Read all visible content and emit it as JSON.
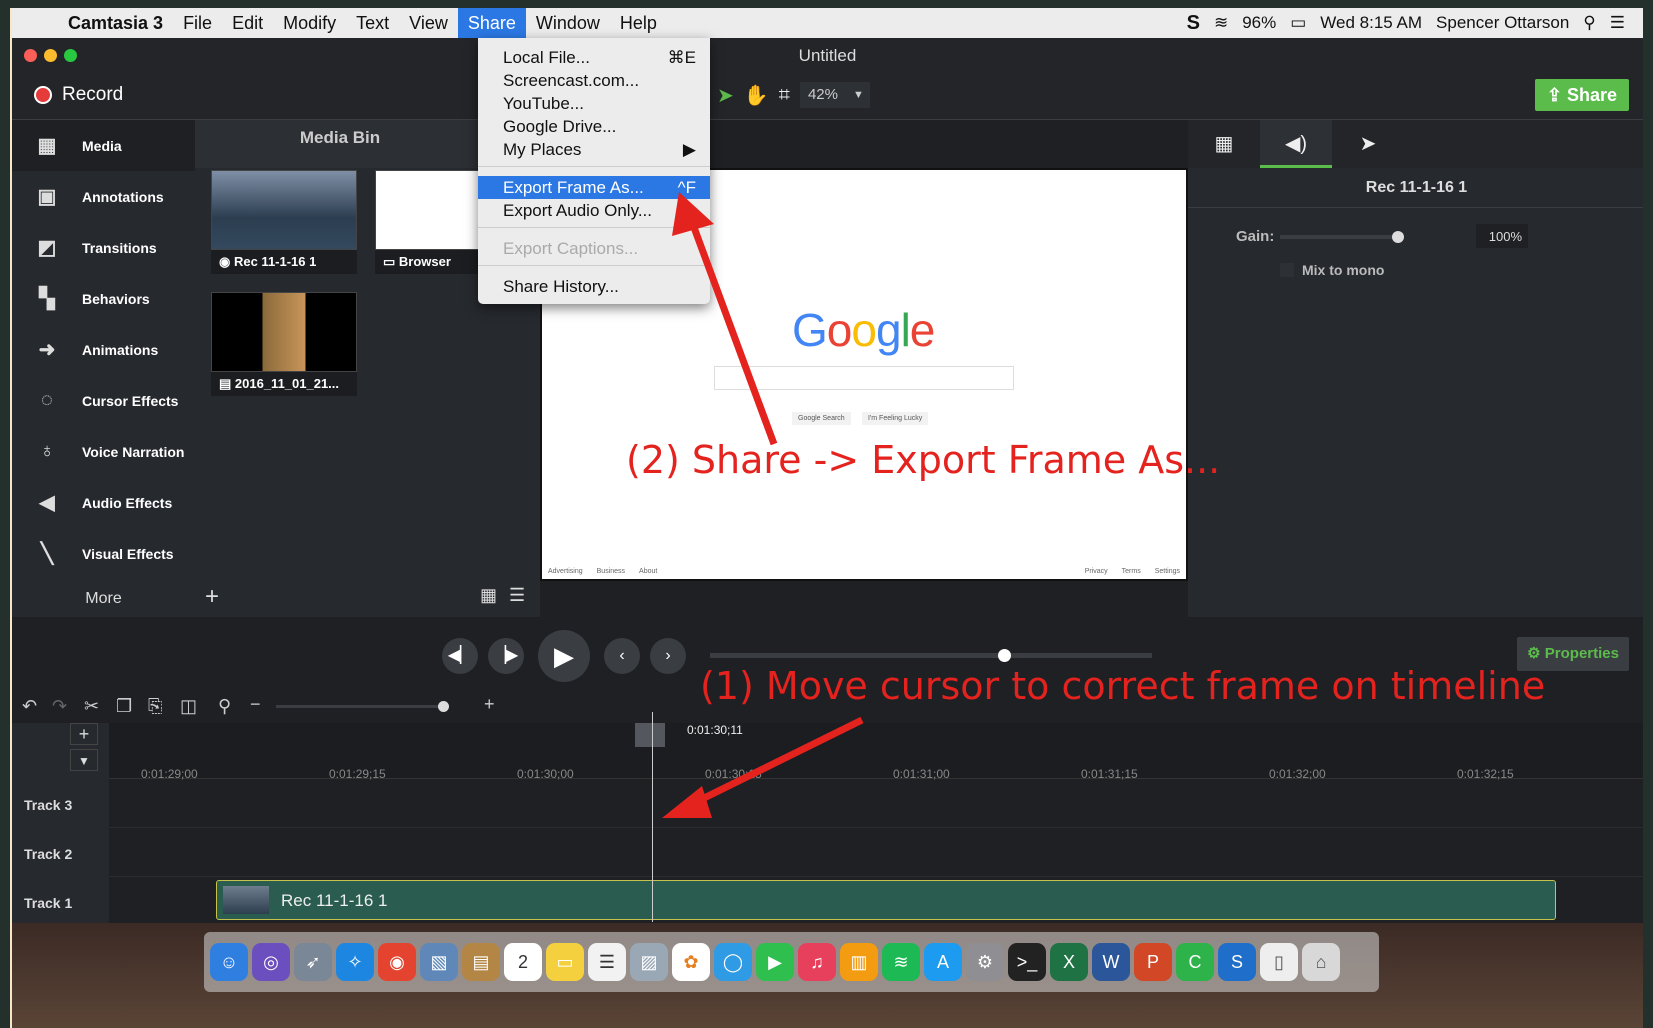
{
  "menubar": {
    "app": "Camtasia 3",
    "items": [
      "File",
      "Edit",
      "Modify",
      "Text",
      "View",
      "Share",
      "Window",
      "Help"
    ],
    "battery": "96%",
    "clock": "Wed 8:15 AM",
    "user": "Spencer Ottarson"
  },
  "window": {
    "title": "Untitled"
  },
  "toolbar": {
    "record": "Record",
    "zoom": "42%",
    "share": "Share"
  },
  "sidebar": {
    "items": [
      "Media",
      "Annotations",
      "Transitions",
      "Behaviors",
      "Animations",
      "Cursor Effects",
      "Voice Narration",
      "Audio Effects",
      "Visual Effects"
    ],
    "more": "More"
  },
  "bin": {
    "title": "Media Bin",
    "items": [
      "Rec 11-1-16 1",
      "Browser",
      "2016_11_01_21..."
    ]
  },
  "share_menu": {
    "items": [
      {
        "label": "Local File...",
        "shortcut": "⌘E"
      },
      {
        "label": "Screencast.com..."
      },
      {
        "label": "YouTube..."
      },
      {
        "label": "Google Drive..."
      },
      {
        "label": "My Places"
      },
      {
        "label": "Export Frame As...",
        "shortcut": "^F"
      },
      {
        "label": "Export Audio Only..."
      },
      {
        "label": "Export Captions..."
      },
      {
        "label": "Share History..."
      }
    ]
  },
  "preview": {
    "logo": "Google",
    "btn1": "Google Search",
    "btn2": "I'm Feeling Lucky",
    "footer_left": [
      "Advertising",
      "Business",
      "About"
    ],
    "footer_right": [
      "Privacy",
      "Terms",
      "Settings"
    ]
  },
  "properties": {
    "clip": "Rec 11-1-16 1",
    "gain_label": "Gain:",
    "gain": "100%",
    "mono": "Mix to mono",
    "button": "Properties"
  },
  "timeline": {
    "playhead_time": "0:01:30;11",
    "ticks": [
      "0:01:29;00",
      "0:01:29;15",
      "0:01:30;00",
      "0:01:30;15",
      "0:01:31;00",
      "0:01:31;15",
      "0:01:32;00",
      "0:01:32;15"
    ],
    "tracks": [
      "Track 3",
      "Track 2",
      "Track 1"
    ],
    "clip": "Rec 11-1-16 1"
  },
  "annotations": {
    "step1": "(1) Move cursor to correct frame on timeline",
    "step2": "(2) Share -> Export Frame As..."
  },
  "colors": {
    "accent": "#5cbc4b",
    "menu_highlight": "#2b78e4",
    "annotation": "#e4221e"
  }
}
